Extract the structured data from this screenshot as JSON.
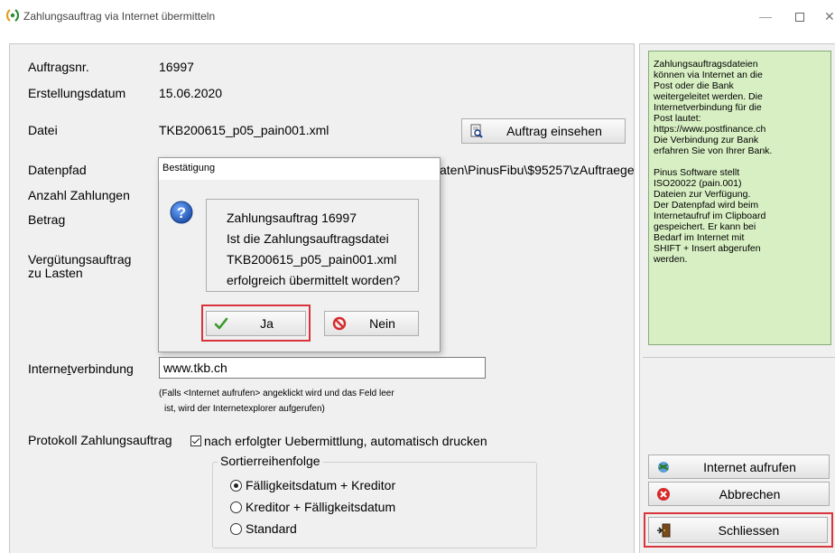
{
  "window": {
    "title": "Zahlungsauftrag via Internet übermitteln",
    "minimize_glyph": "—",
    "close_glyph": "✕"
  },
  "form": {
    "auftragsnr_label": "Auftragsnr.",
    "auftragsnr_value": "16997",
    "datum_label": "Erstellungsdatum",
    "datum_value": "15.06.2020",
    "datei_label": "Datei",
    "datei_value": "TKB200615_p05_pain001.xml",
    "auftrag_einsehen_label": "Auftrag einsehen",
    "datenpfad_label": "Datenpfad",
    "datenpfad_value": "aten\\PinusFibu\\$95257\\zAuftraege",
    "anzahl_label": "Anzahl Zahlungen",
    "betrag_label": "Betrag",
    "verguetung_label_1": "Vergütungsauftrag",
    "verguetung_label_2": "zu Lasten",
    "internet_label_pre": "Interne",
    "internet_label_ul": "t",
    "internet_label_post": "verbindung",
    "internet_value": "www.tkb.ch",
    "internet_note_1": "(Falls <Internet aufrufen> angeklickt wird und das Feld leer",
    "internet_note_2": "ist, wird der Internetexplorer aufgerufen)",
    "protokoll_label": "Protokoll Zahlungsauftrag",
    "protokoll_checkbox_label": "nach erfolgter Uebermittlung, automatisch drucken",
    "protokoll_checked": true,
    "sort_legend": "Sortierreihenfolge",
    "sort_options": [
      {
        "label": "Fälligkeitsdatum + Kreditor",
        "selected": true
      },
      {
        "label": "Kreditor + Fälligkeitsdatum",
        "selected": false
      },
      {
        "label": "Standard",
        "selected": false
      }
    ]
  },
  "help": {
    "paragraph_1": "Zahlungsauftragsdateien\nkönnen via Internet an die\nPost oder die Bank\nweitergeleitet werden. Die\nInternetverbindung für die\nPost lautet:\nhttps://www.postfinance.ch\nDie Verbindung zur Bank\nerfahren Sie von Ihrer Bank.",
    "paragraph_2": "Pinus Software stellt\nISO20022 (pain.001)\nDateien zur Verfügung.\nDer Datenpfad wird beim\nInternetaufruf im Clipboard\ngespeichert. Er kann bei\nBedarf im Internet mit\nSHIFT + Insert abgerufen\nwerden.",
    "background_color": "#d7efc3"
  },
  "side_buttons": {
    "internet_aufrufen": "Internet aufrufen",
    "abbrechen": "Abbrechen",
    "schliessen": "Schliessen"
  },
  "dialog": {
    "title": "Bestätigung",
    "message_lines": [
      "Zahlungsauftrag 16997",
      "Ist die Zahlungsauftragsdatei",
      "TKB200615_p05_pain001.xml",
      "erfolgreich übermittelt worden?"
    ],
    "yes_label": "Ja",
    "no_label": "Nein"
  },
  "colors": {
    "highlight": "#d9343c",
    "question_icon": "#1f5fbf",
    "check_green": "#3a9a2a",
    "stop_red": "#d52b2b"
  }
}
